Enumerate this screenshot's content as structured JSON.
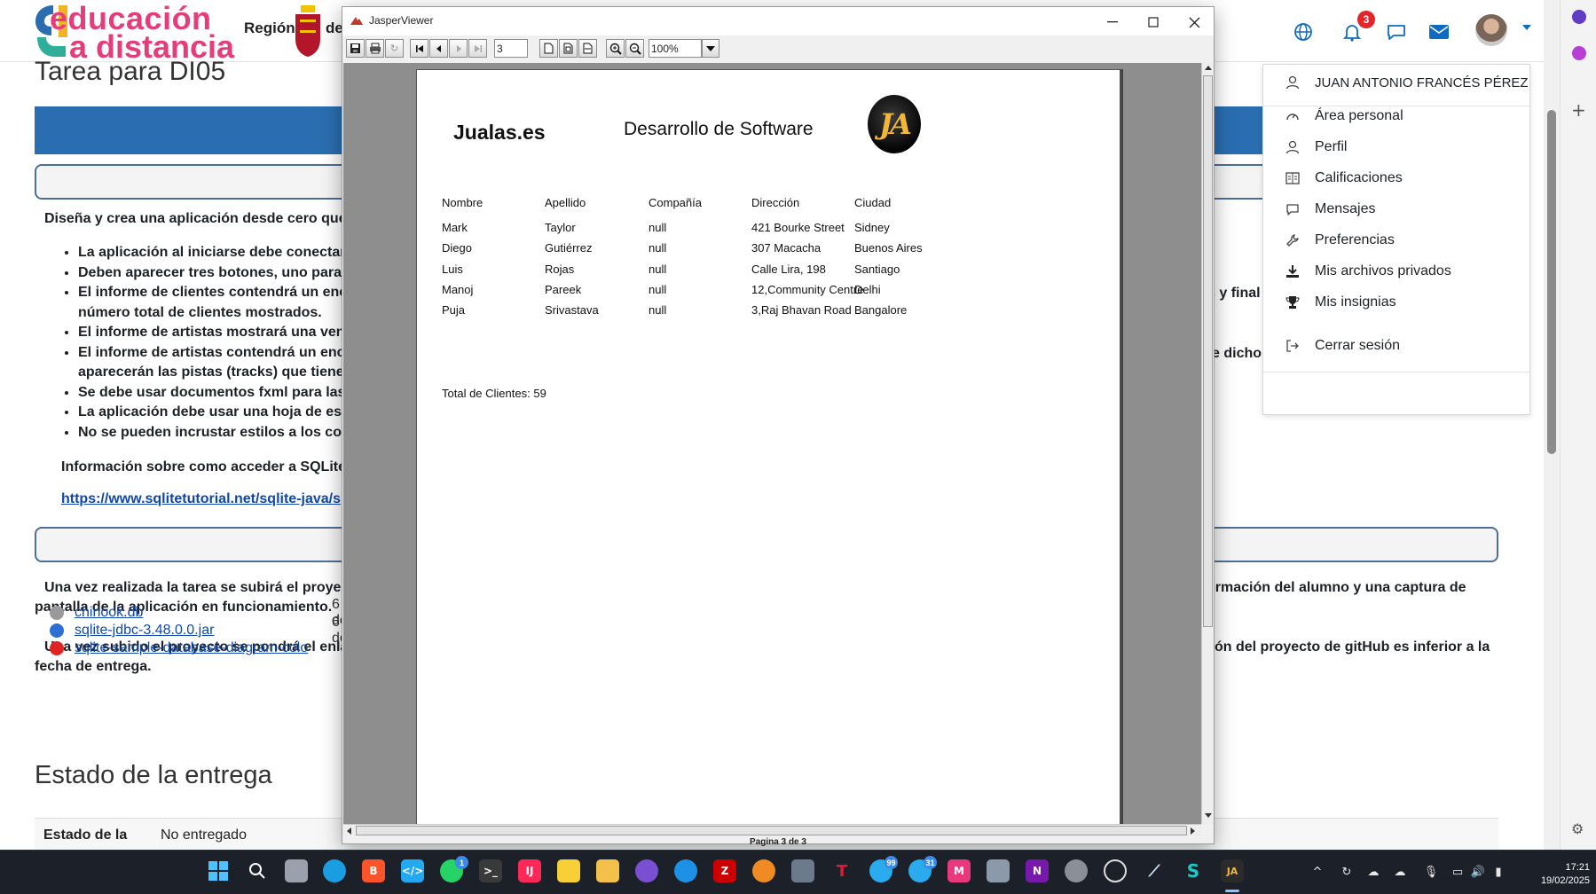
{
  "browser": {
    "logo_line1": "educación",
    "logo_line2": "a distancia",
    "region_label": "Región",
    "region_label_cut": "de",
    "notification_count": "3",
    "user_name": "JUAN ANTONIO FRANCÉS PÉREZ",
    "user_menu": [
      {
        "label": "Área personal",
        "icon": "dashboard-icon"
      },
      {
        "label": "Perfil",
        "icon": "user-icon"
      },
      {
        "label": "Calificaciones",
        "icon": "grades-icon"
      },
      {
        "label": "Mensajes",
        "icon": "message-icon"
      },
      {
        "label": "Preferencias",
        "icon": "wrench-icon"
      },
      {
        "label": "Mis archivos privados",
        "icon": "download-icon"
      },
      {
        "label": "Mis insignias",
        "icon": "trophy-icon"
      },
      {
        "label": "Cerrar sesión",
        "icon": "logout-icon"
      }
    ],
    "accent_color": "#0f6cbf",
    "banner_color": "#2a6eb1"
  },
  "course_page": {
    "task_title": "Tarea para DI05",
    "intro_text": "Diseña y crea una aplicación desde cero que",
    "bullets": [
      "La aplicación al iniciarse debe conectar",
      "Deben aparecer tres botones, uno para",
      "El informe de clientes contendrá un enc",
      "número total de clientes mostrados.",
      "El informe de artistas mostrará una ven",
      "El informe de artistas contendrá un enc",
      "aparecerán las pistas (tracks) que tiene",
      "Se debe usar documentos fxml para las",
      "La aplicación debe usar una hoja de est",
      "No se pueden incrustar estilos a los con"
    ],
    "right_fragment_1": "s y final",
    "right_fragment_2": "e dicho",
    "sqlite_info": "Información sobre como acceder a SQLite",
    "sqlite_link": "https://www.sqlitetutorial.net/sqlite-java/s",
    "submit_text_1_left": "Una vez realizada la tarea  se subirá el proye",
    "submit_text_1_right": "ormación del alumno y una captura de",
    "submit_text_1_line2": "pantalla de la aplicación en funcionamiento.",
    "submit_text_2_left": "Una vez subido el proyecto se pondrá el enla",
    "submit_text_2_right": "ón del proyecto de gitHub es inferior a la",
    "submit_text_2_line2": "fecha de entrega.",
    "files": [
      {
        "name": "chinook.db",
        "date": "6 de",
        "color": "#9a9a9a"
      },
      {
        "name": "sqlite-jdbc-3.48.0.0.jar",
        "date": "6 de",
        "color": "#2d6fd3"
      },
      {
        "name": "sqlite-sample-database-diagram-colo",
        "date": "",
        "color": "#e02424"
      }
    ],
    "estado_title": "Estado de la entrega",
    "estado_label": "Estado de la",
    "estado_value": "No entregado"
  },
  "jasper": {
    "window_title": "JasperViewer",
    "page_input": "3",
    "zoom": "100%",
    "status": "Pagina 3 de 3",
    "report": {
      "company": "Jualas.es",
      "subtitle": "Desarrollo de Software",
      "logo_text": "JA",
      "headers": [
        "Nombre",
        "Apellido",
        "Compañía",
        "Dirección",
        "Ciudad"
      ],
      "rows": [
        [
          "Mark",
          "Taylor",
          "null",
          "421 Bourke Street",
          "Sidney"
        ],
        [
          "Diego",
          "Gutiérrez",
          "null",
          "307 Macacha",
          "Buenos Aires"
        ],
        [
          "Luis",
          "Rojas",
          "null",
          "Calle Lira, 198",
          "Santiago"
        ],
        [
          "Manoj",
          "Pareek",
          "null",
          "12,Community Centre",
          "Delhi"
        ],
        [
          "Puja",
          "Srivastava",
          "null",
          "3,Raj Bhavan Road",
          "Bangalore"
        ]
      ],
      "total_label": "Total de Clientes: 59"
    }
  },
  "taskbar": {
    "clock_time": "17:21",
    "clock_date": "19/02/2025",
    "badges": {
      "whatsapp": "1",
      "telegram": "99",
      "telegram2": "31"
    }
  }
}
